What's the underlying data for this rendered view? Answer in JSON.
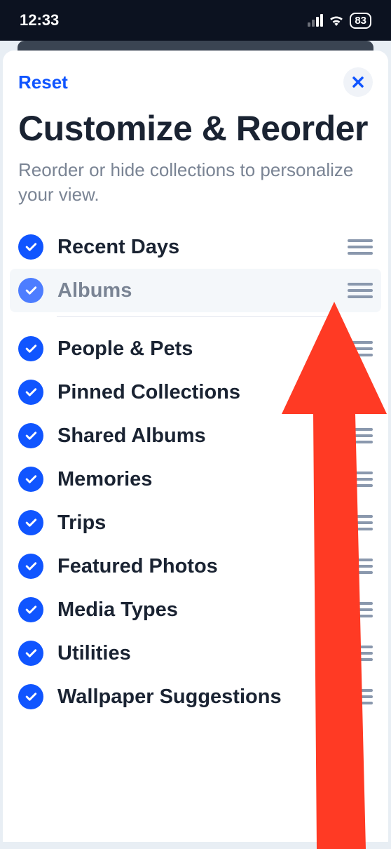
{
  "status_bar": {
    "time": "12:33",
    "battery": "83"
  },
  "header": {
    "reset_label": "Reset"
  },
  "title": "Customize & Reorder",
  "subtitle": "Reorder or hide collections to personalize your view.",
  "items_group1": [
    {
      "label": "Recent Days"
    },
    {
      "label": "Albums",
      "dragging": true
    }
  ],
  "items_group2": [
    {
      "label": "People & Pets"
    },
    {
      "label": "Pinned Collections"
    },
    {
      "label": "Shared Albums"
    },
    {
      "label": "Memories"
    },
    {
      "label": "Trips"
    },
    {
      "label": "Featured Photos"
    },
    {
      "label": "Media Types"
    },
    {
      "label": "Utilities"
    },
    {
      "label": "Wallpaper Suggestions"
    }
  ]
}
